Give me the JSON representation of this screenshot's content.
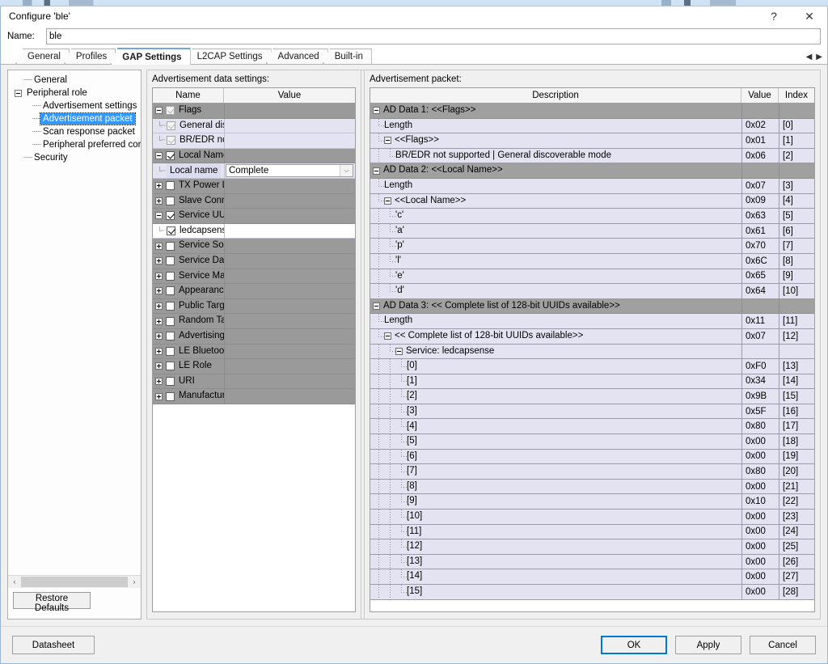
{
  "window": {
    "title": "Configure 'ble'",
    "help_button": "?",
    "close_button": "✕"
  },
  "name_field": {
    "label": "Name:",
    "value": "ble",
    "placeholder": ""
  },
  "tabs": {
    "items": [
      {
        "label": "General",
        "active": false
      },
      {
        "label": "Profiles",
        "active": false
      },
      {
        "label": "GAP Settings",
        "active": true
      },
      {
        "label": "L2CAP Settings",
        "active": false
      },
      {
        "label": "Advanced",
        "active": false
      },
      {
        "label": "Built-in",
        "active": false
      }
    ],
    "scroll_left": "◀",
    "scroll_right": "▶"
  },
  "nav_tree": {
    "items": [
      {
        "label": "General",
        "depth": 1,
        "expander": "none",
        "selected": false
      },
      {
        "label": "Peripheral role",
        "depth": 0,
        "expander": "minus",
        "selected": false
      },
      {
        "label": "Advertisement settings",
        "depth": 2,
        "expander": "none",
        "selected": false
      },
      {
        "label": "Advertisement packet",
        "depth": 2,
        "expander": "none",
        "selected": true
      },
      {
        "label": "Scan response packet",
        "depth": 2,
        "expander": "none",
        "selected": false
      },
      {
        "label": "Peripheral preferred conne",
        "depth": 2,
        "expander": "none",
        "selected": false
      },
      {
        "label": "Security",
        "depth": 1,
        "expander": "none",
        "selected": false
      }
    ],
    "hscroll_left": "‹",
    "hscroll_right": "›"
  },
  "restore_defaults_button": "Restore Defaults",
  "settings_panel": {
    "caption": "Advertisement data settings:",
    "columns": [
      "Name",
      "Value"
    ],
    "rows": [
      {
        "label": "Flags",
        "depth": 0,
        "expander": "minus",
        "checkbox": "checked-dim",
        "value": "",
        "style": "group"
      },
      {
        "label": "General discoverable mode",
        "depth": 1,
        "expander": "none",
        "checkbox": "checked-dim",
        "value": "",
        "style": "child"
      },
      {
        "label": "BR/EDR not supported",
        "depth": 1,
        "expander": "none",
        "checkbox": "checked-dim",
        "value": "",
        "style": "child"
      },
      {
        "label": "Local Name",
        "depth": 0,
        "expander": "minus",
        "checkbox": "checked",
        "value": "",
        "style": "group"
      },
      {
        "label": "Local name",
        "depth": 1,
        "expander": "none",
        "checkbox": "none",
        "value": "Complete",
        "style": "child-combo"
      },
      {
        "label": "TX Power Level",
        "depth": 0,
        "expander": "plus",
        "checkbox": "unchecked",
        "value": "",
        "style": "group"
      },
      {
        "label": "Slave Connection Interval Range",
        "depth": 0,
        "expander": "plus",
        "checkbox": "unchecked",
        "value": "",
        "style": "group"
      },
      {
        "label": "Service UUID",
        "depth": 0,
        "expander": "minus",
        "checkbox": "checked",
        "value": "",
        "style": "group"
      },
      {
        "label": "ledcapsense",
        "depth": 1,
        "expander": "none",
        "checkbox": "checked",
        "value": "",
        "style": "child-white"
      },
      {
        "label": "Service Solicitation",
        "depth": 0,
        "expander": "plus",
        "checkbox": "unchecked",
        "value": "",
        "style": "group"
      },
      {
        "label": "Service Data",
        "depth": 0,
        "expander": "plus",
        "checkbox": "unchecked",
        "value": "",
        "style": "group"
      },
      {
        "label": "Service Manager TK Value",
        "depth": 0,
        "expander": "plus",
        "checkbox": "unchecked",
        "value": "",
        "style": "group"
      },
      {
        "label": "Appearance",
        "depth": 0,
        "expander": "plus",
        "checkbox": "unchecked",
        "value": "",
        "style": "group"
      },
      {
        "label": "Public Target Address",
        "depth": 0,
        "expander": "plus",
        "checkbox": "unchecked",
        "value": "",
        "style": "group"
      },
      {
        "label": "Random Target Address",
        "depth": 0,
        "expander": "plus",
        "checkbox": "unchecked",
        "value": "",
        "style": "group"
      },
      {
        "label": "Advertising Interval",
        "depth": 0,
        "expander": "plus",
        "checkbox": "unchecked",
        "value": "",
        "style": "group"
      },
      {
        "label": "LE Bluetooth Device Address",
        "depth": 0,
        "expander": "plus",
        "checkbox": "unchecked",
        "value": "",
        "style": "group"
      },
      {
        "label": "LE Role",
        "depth": 0,
        "expander": "plus",
        "checkbox": "unchecked",
        "value": "",
        "style": "group"
      },
      {
        "label": "URI",
        "depth": 0,
        "expander": "plus",
        "checkbox": "unchecked",
        "value": "",
        "style": "group"
      },
      {
        "label": "Manufacturer Specific Data",
        "depth": 0,
        "expander": "plus",
        "checkbox": "unchecked",
        "value": "",
        "style": "group"
      }
    ]
  },
  "packet_panel": {
    "caption": "Advertisement packet:",
    "columns": [
      "Description",
      "Value",
      "Index"
    ],
    "rows": [
      {
        "desc": "AD Data 1: <<Flags>>",
        "value": "",
        "index": "",
        "depth": 0,
        "expander": "minus",
        "group": true
      },
      {
        "desc": "Length",
        "value": "0x02",
        "index": "[0]",
        "depth": 1,
        "expander": "none",
        "group": false
      },
      {
        "desc": "<<Flags>>",
        "value": "0x01",
        "index": "[1]",
        "depth": 1,
        "expander": "minus",
        "group": false
      },
      {
        "desc": "BR/EDR not supported | General discoverable mode",
        "value": "0x06",
        "index": "[2]",
        "depth": 2,
        "expander": "none",
        "group": false
      },
      {
        "desc": "AD Data 2: <<Local Name>>",
        "value": "",
        "index": "",
        "depth": 0,
        "expander": "minus",
        "group": true
      },
      {
        "desc": "Length",
        "value": "0x07",
        "index": "[3]",
        "depth": 1,
        "expander": "none",
        "group": false
      },
      {
        "desc": "<<Local Name>>",
        "value": "0x09",
        "index": "[4]",
        "depth": 1,
        "expander": "minus",
        "group": false
      },
      {
        "desc": "'c'",
        "value": "0x63",
        "index": "[5]",
        "depth": 2,
        "expander": "none",
        "group": false
      },
      {
        "desc": "'a'",
        "value": "0x61",
        "index": "[6]",
        "depth": 2,
        "expander": "none",
        "group": false
      },
      {
        "desc": "'p'",
        "value": "0x70",
        "index": "[7]",
        "depth": 2,
        "expander": "none",
        "group": false
      },
      {
        "desc": "'l'",
        "value": "0x6C",
        "index": "[8]",
        "depth": 2,
        "expander": "none",
        "group": false
      },
      {
        "desc": "'e'",
        "value": "0x65",
        "index": "[9]",
        "depth": 2,
        "expander": "none",
        "group": false
      },
      {
        "desc": "'d'",
        "value": "0x64",
        "index": "[10]",
        "depth": 2,
        "expander": "none",
        "group": false
      },
      {
        "desc": "AD Data 3: << Complete list of 128-bit UUIDs available>>",
        "value": "",
        "index": "",
        "depth": 0,
        "expander": "minus",
        "group": true
      },
      {
        "desc": "Length",
        "value": "0x11",
        "index": "[11]",
        "depth": 1,
        "expander": "none",
        "group": false
      },
      {
        "desc": "<< Complete list of 128-bit UUIDs available>>",
        "value": "0x07",
        "index": "[12]",
        "depth": 1,
        "expander": "minus",
        "group": false
      },
      {
        "desc": "Service: ledcapsense",
        "value": "",
        "index": "",
        "depth": 2,
        "expander": "minus",
        "group": false
      },
      {
        "desc": "[0]",
        "value": "0xF0",
        "index": "[13]",
        "depth": 3,
        "expander": "none",
        "group": false
      },
      {
        "desc": "[1]",
        "value": "0x34",
        "index": "[14]",
        "depth": 3,
        "expander": "none",
        "group": false
      },
      {
        "desc": "[2]",
        "value": "0x9B",
        "index": "[15]",
        "depth": 3,
        "expander": "none",
        "group": false
      },
      {
        "desc": "[3]",
        "value": "0x5F",
        "index": "[16]",
        "depth": 3,
        "expander": "none",
        "group": false
      },
      {
        "desc": "[4]",
        "value": "0x80",
        "index": "[17]",
        "depth": 3,
        "expander": "none",
        "group": false
      },
      {
        "desc": "[5]",
        "value": "0x00",
        "index": "[18]",
        "depth": 3,
        "expander": "none",
        "group": false
      },
      {
        "desc": "[6]",
        "value": "0x00",
        "index": "[19]",
        "depth": 3,
        "expander": "none",
        "group": false
      },
      {
        "desc": "[7]",
        "value": "0x80",
        "index": "[20]",
        "depth": 3,
        "expander": "none",
        "group": false
      },
      {
        "desc": "[8]",
        "value": "0x00",
        "index": "[21]",
        "depth": 3,
        "expander": "none",
        "group": false
      },
      {
        "desc": "[9]",
        "value": "0x10",
        "index": "[22]",
        "depth": 3,
        "expander": "none",
        "group": false
      },
      {
        "desc": "[10]",
        "value": "0x00",
        "index": "[23]",
        "depth": 3,
        "expander": "none",
        "group": false
      },
      {
        "desc": "[11]",
        "value": "0x00",
        "index": "[24]",
        "depth": 3,
        "expander": "none",
        "group": false
      },
      {
        "desc": "[12]",
        "value": "0x00",
        "index": "[25]",
        "depth": 3,
        "expander": "none",
        "group": false
      },
      {
        "desc": "[13]",
        "value": "0x00",
        "index": "[26]",
        "depth": 3,
        "expander": "none",
        "group": false
      },
      {
        "desc": "[14]",
        "value": "0x00",
        "index": "[27]",
        "depth": 3,
        "expander": "none",
        "group": false
      },
      {
        "desc": "[15]",
        "value": "0x00",
        "index": "[28]",
        "depth": 3,
        "expander": "none",
        "group": false
      }
    ]
  },
  "footer": {
    "datasheet": "Datasheet",
    "ok": "OK",
    "apply": "Apply",
    "cancel": "Cancel"
  },
  "colors": {
    "selection_blue": "#3399ff",
    "default_button_border": "#0078d7",
    "group_row": "#9a9a9a",
    "child_row": "#e3e3f2",
    "active_tab_border": "#6fa8d8"
  }
}
